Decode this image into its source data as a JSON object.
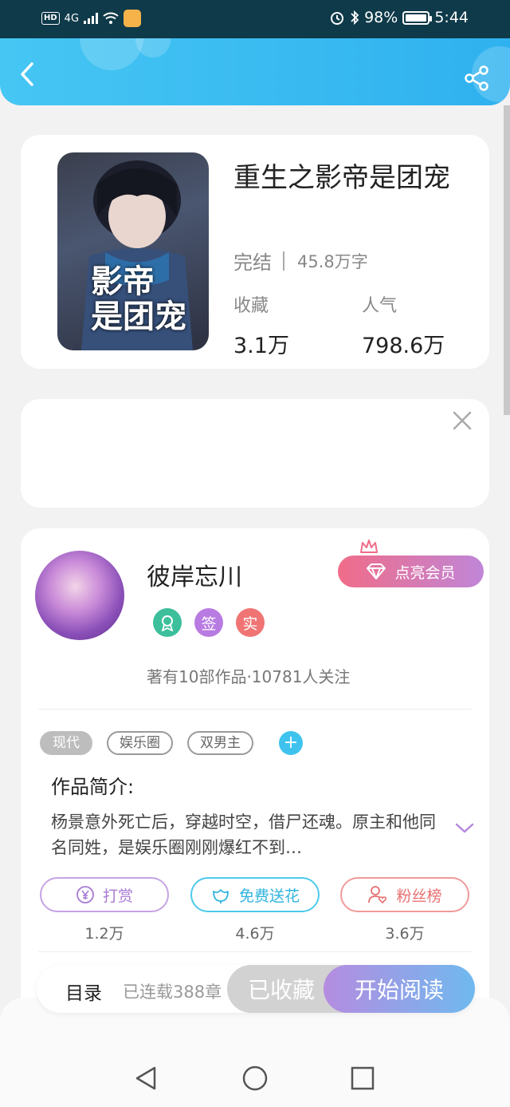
{
  "status_bar": {
    "network": "HD",
    "signal": "4G",
    "battery_percent": "98%",
    "battery_level": 0.98,
    "time": "5:44"
  },
  "header": {
    "back_icon": "back-chevron-icon",
    "share_icon": "share-icon"
  },
  "book": {
    "cover_title": "影帝\n是团宠",
    "title": "重生之影帝是团宠",
    "status": "完结",
    "word_count": "45.8万字",
    "favorites_label": "收藏",
    "favorites_value": "3.1万",
    "popularity_label": "人气",
    "popularity_value": "798.6万"
  },
  "ad": {
    "close_icon": "close-icon"
  },
  "author": {
    "name": "彼岸忘川",
    "vip_label": "点亮会员",
    "badges": [
      "签",
      "实"
    ],
    "stats": "著有10部作品·10781人关注"
  },
  "tags": {
    "items": [
      "现代",
      "娱乐圈",
      "双男主"
    ],
    "add_label": "+"
  },
  "intro": {
    "heading": "作品简介:",
    "text": "杨景意外死亡后，穿越时空，借尸还魂。原主和他同名同姓，是娱乐圈刚刚爆红不到…"
  },
  "actions": {
    "tip": {
      "label": "打赏",
      "count": "1.2万"
    },
    "flower": {
      "label": "免费送花",
      "count": "4.6万"
    },
    "fans": {
      "label": "粉丝榜",
      "count": "3.6万"
    }
  },
  "bottom_bar": {
    "toc_label": "目录",
    "serial_label": "已连载388章",
    "favorited_label": "已收藏",
    "read_label": "开始阅读"
  },
  "colors": {
    "header_blue": "#2fb1ef",
    "vip_pink": "#f06c88",
    "read_gradient_start": "#b58ce0",
    "read_gradient_end": "#6fb9ef"
  }
}
